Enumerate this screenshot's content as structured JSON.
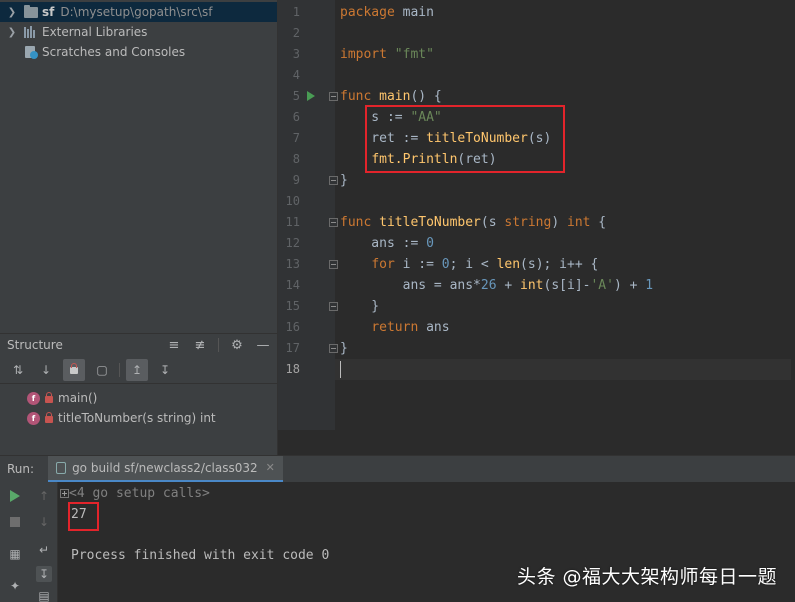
{
  "project_tree": {
    "items": [
      {
        "name": "sf",
        "path": "D:\\mysetup\\gopath\\src\\sf",
        "icon": "folder-icon"
      },
      {
        "name": "External Libraries",
        "icon": "library-icon"
      },
      {
        "name": "Scratches and Consoles",
        "icon": "scratch-icon"
      }
    ]
  },
  "structure": {
    "title": "Structure",
    "items": [
      {
        "badge": "f",
        "label": "main()"
      },
      {
        "badge": "f",
        "label": "titleToNumber(s string) int"
      }
    ]
  },
  "editor": {
    "line_numbers": [
      "1",
      "2",
      "3",
      "4",
      "5",
      "6",
      "7",
      "8",
      "9",
      "10",
      "11",
      "12",
      "13",
      "14",
      "15",
      "16",
      "17",
      "18"
    ],
    "current_line": "18"
  },
  "run": {
    "label": "Run:",
    "tab_label": "go build sf/newclass2/class032",
    "console": {
      "setup_calls": "<4 go setup calls>",
      "output": "27",
      "finished": "Process finished with exit code 0"
    }
  },
  "watermark": "头条 @福大大架构师每日一题",
  "colors": {
    "highlight_box": "#e3242b",
    "keyword": "#cc7832",
    "string": "#6a8759",
    "function": "#ffc66d",
    "number": "#6897bb"
  }
}
